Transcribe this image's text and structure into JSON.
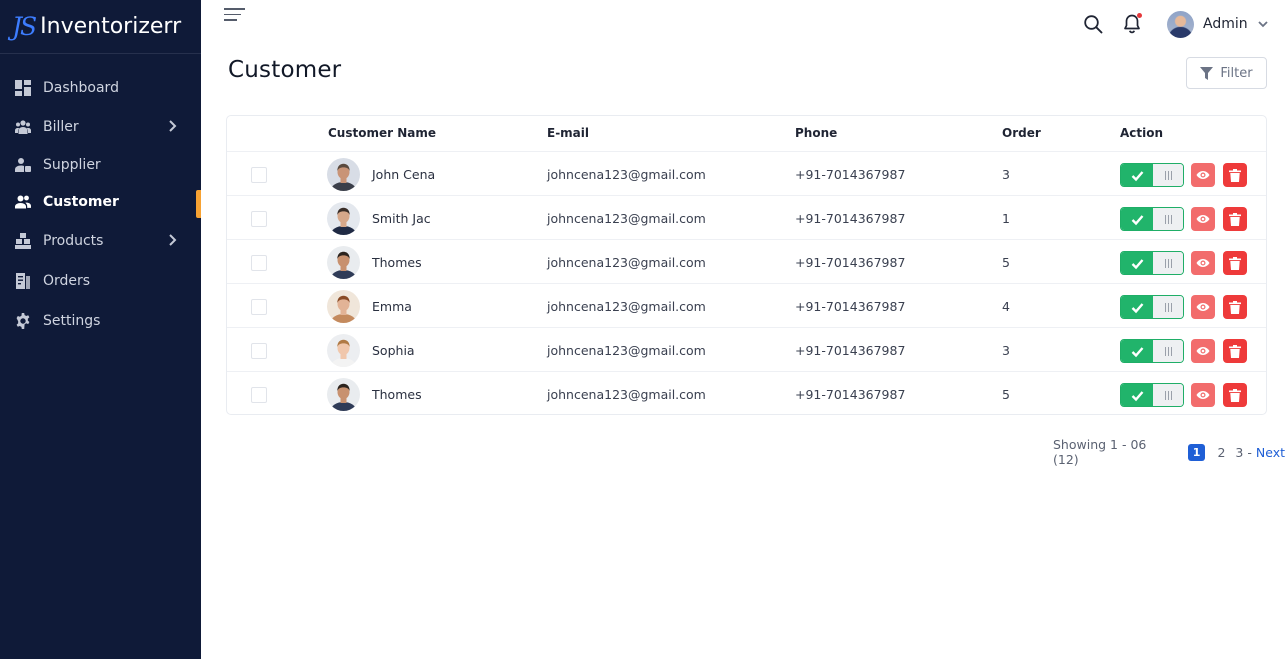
{
  "brand": {
    "mark": "JS",
    "name": "Inventorizerr"
  },
  "sidebar": {
    "items": [
      {
        "label": "Dashboard",
        "icon": "dashboard-icon",
        "has_submenu": false,
        "active": false
      },
      {
        "label": "Biller",
        "icon": "users-group-icon",
        "has_submenu": true,
        "active": false
      },
      {
        "label": "Supplier",
        "icon": "supplier-icon",
        "has_submenu": false,
        "active": false
      },
      {
        "label": "Customer",
        "icon": "customer-icon",
        "has_submenu": false,
        "active": true
      },
      {
        "label": "Products",
        "icon": "boxes-icon",
        "has_submenu": true,
        "active": false
      },
      {
        "label": "Orders",
        "icon": "orders-icon",
        "has_submenu": false,
        "active": false
      },
      {
        "label": "Settings",
        "icon": "gear-icon",
        "has_submenu": false,
        "active": false
      }
    ]
  },
  "header": {
    "user_name": "Admin"
  },
  "page": {
    "title": "Customer",
    "filter_label": "Filter"
  },
  "table": {
    "columns": [
      "Customer Name",
      "E-mail",
      "Phone",
      "Order",
      "Action"
    ],
    "rows": [
      {
        "name": "John Cena",
        "email": "johncena123@gmail.com",
        "phone": "+91-7014367987",
        "order": "3",
        "active": true
      },
      {
        "name": "Smith Jac",
        "email": "johncena123@gmail.com",
        "phone": "+91-7014367987",
        "order": "1",
        "active": true
      },
      {
        "name": "Thomes",
        "email": "johncena123@gmail.com",
        "phone": "+91-7014367987",
        "order": "5",
        "active": true
      },
      {
        "name": "Emma",
        "email": "johncena123@gmail.com",
        "phone": "+91-7014367987",
        "order": "4",
        "active": true
      },
      {
        "name": "Sophia",
        "email": "johncena123@gmail.com",
        "phone": "+91-7014367987",
        "order": "3",
        "active": true
      },
      {
        "name": "Thomes",
        "email": "johncena123@gmail.com",
        "phone": "+91-7014367987",
        "order": "5",
        "active": true
      }
    ]
  },
  "pagination": {
    "info": "Showing 1 - 06 (12)",
    "current": "1",
    "pages": [
      "2",
      "3"
    ],
    "separator": "-",
    "next": "Next"
  },
  "colors": {
    "sidebar_bg": "#0f1a38",
    "active_indicator": "#f7a233",
    "toggle_on": "#21b46b",
    "view_button": "#f26c6c",
    "delete_button": "#ee3a3a",
    "link": "#1f5fd6"
  }
}
